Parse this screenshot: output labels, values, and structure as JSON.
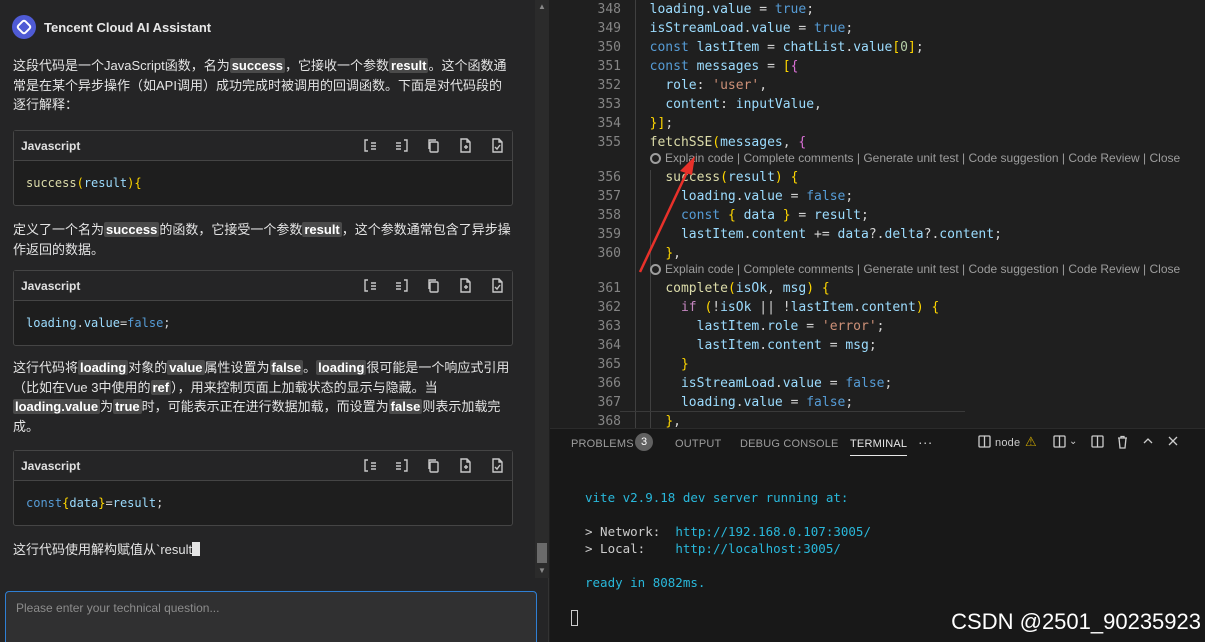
{
  "assistant": {
    "title": "Tencent Cloud AI Assistant",
    "messages": [
      {
        "segments": [
          "这段代码是一个JavaScript函数，名为",
          "success",
          "，它接收一个参数",
          "result",
          "。这个函数通常是在某个异步操作（如API调用）成功完成时被调用的回调函数。下面是对代码段的逐行解释："
        ]
      },
      {
        "code": {
          "language": "Javascript",
          "text": "success(result) {"
        }
      },
      {
        "segments": [
          "定义了一个名为",
          "success",
          "的函数，它接受一个参数",
          "result",
          "，这个参数通常包含了异步操作返回的数据。"
        ]
      },
      {
        "code": {
          "language": "Javascript",
          "text": "        loading.value = false;"
        }
      },
      {
        "segments": [
          "这行代码将",
          "loading",
          "对象的",
          "value",
          "属性设置为",
          "false",
          "。",
          "loading",
          "很可能是一个响应式引用（比如在Vue 3中使用的",
          "ref",
          "），用来控制页面上加载状态的显示与隐藏。当",
          "loading.value",
          "为",
          "true",
          "时，可能表示正在进行数据加载，而设置为",
          "false",
          "则表示加载完成。"
        ]
      },
      {
        "code": {
          "language": "Javascript",
          "text": "        const { data } = result;"
        }
      },
      {
        "segments": [
          "这行代码使用解构赋值从`result"
        ]
      }
    ],
    "input_placeholder": "Please enter your technical question...",
    "toolbar_icons": [
      "insert-icon",
      "insert-left-icon",
      "copy-icon",
      "new-file-icon",
      "apply-icon"
    ]
  },
  "editor": {
    "lines": [
      {
        "n": "348",
        "text": "  loading.value = true;"
      },
      {
        "n": "349",
        "text": "  isStreamLoad.value = true;"
      },
      {
        "n": "350",
        "text": "  const lastItem = chatList.value[0];"
      },
      {
        "n": "351",
        "text": "  const messages = [{"
      },
      {
        "n": "352",
        "text": "    role: 'user',"
      },
      {
        "n": "353",
        "text": "    content: inputValue,"
      },
      {
        "n": "354",
        "text": "  }];"
      },
      {
        "n": "355",
        "text": "  fetchSSE(messages, {"
      },
      {
        "n": "356",
        "text": "    success(result) {"
      },
      {
        "n": "357",
        "text": "      loading.value = false;"
      },
      {
        "n": "358",
        "text": "      const { data } = result;"
      },
      {
        "n": "359",
        "text": "      lastItem.content += data?.delta?.content;"
      },
      {
        "n": "360",
        "text": "    },"
      },
      {
        "n": "361",
        "text": "    complete(isOk, msg) {"
      },
      {
        "n": "362",
        "text": "      if (!isOk || !lastItem.content) {"
      },
      {
        "n": "363",
        "text": "        lastItem.role = 'error';"
      },
      {
        "n": "364",
        "text": "        lastItem.content = msg;"
      },
      {
        "n": "365",
        "text": "      }"
      },
      {
        "n": "366",
        "text": "      isStreamLoad.value = false;"
      },
      {
        "n": "367",
        "text": "      loading.value = false;"
      },
      {
        "n": "368",
        "text": "    },"
      }
    ],
    "codelens": "Explain code | Complete comments | Generate unit test | Code suggestion | Code Review | Close"
  },
  "panel": {
    "tabs": [
      "PROBLEMS",
      "OUTPUT",
      "DEBUG CONSOLE",
      "TERMINAL"
    ],
    "problems_count": "3",
    "more": "···",
    "terminal_name": "node",
    "terminal": {
      "line1": "vite v2.9.18 dev server running at:",
      "network_label": "> Network:  ",
      "network_url": "http://192.168.0.107:3005/",
      "local_label": "> Local:    ",
      "local_url": "http://localhost:3005/",
      "ready": "ready in 8082ms."
    }
  },
  "watermark": "CSDN @2501_90235923"
}
